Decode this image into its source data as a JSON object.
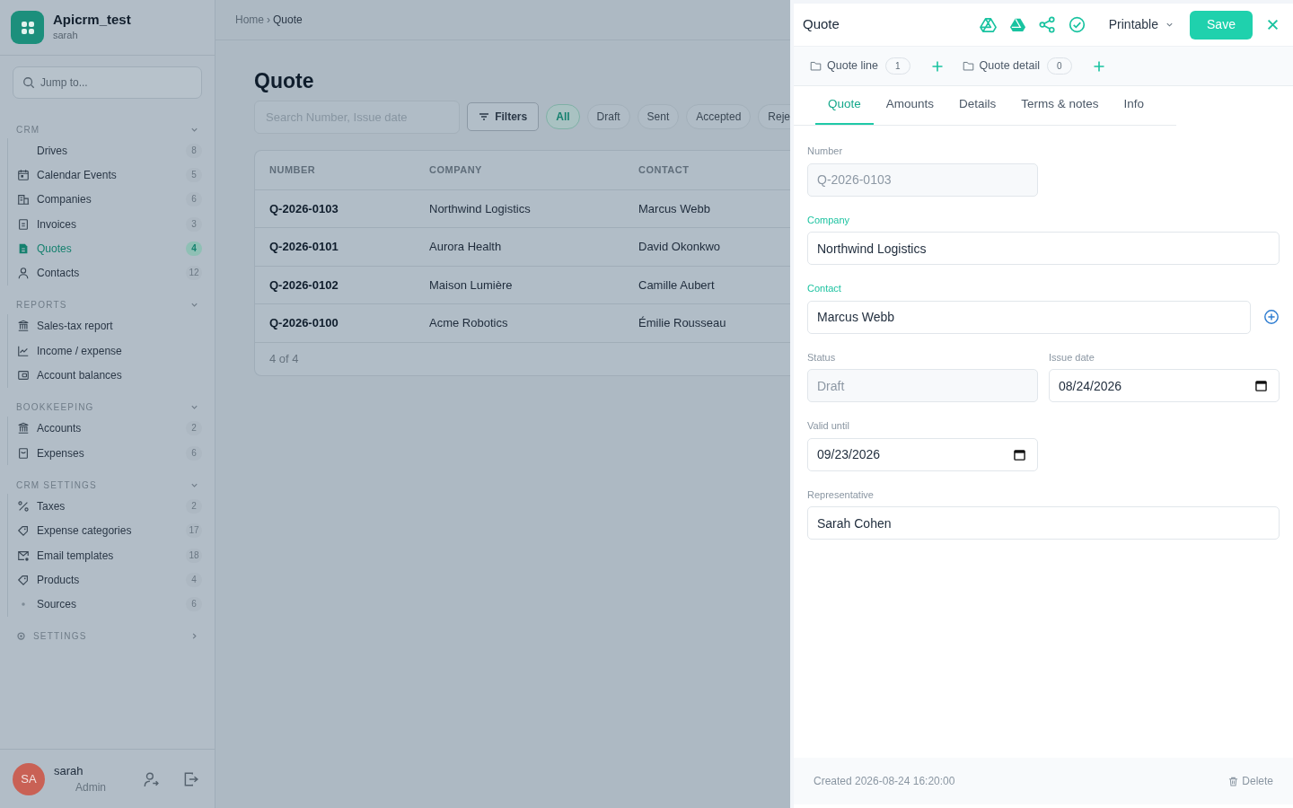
{
  "app": {
    "name": "Apicrm_test",
    "user": "sarah"
  },
  "jump": {
    "placeholder": "Jump to..."
  },
  "nav_sections": [
    {
      "title": "CRM",
      "expanded": true,
      "items": [
        {
          "label": "Drives",
          "count": "8",
          "selected": false
        },
        {
          "label": "Calendar Events",
          "count": "5",
          "selected": false
        },
        {
          "label": "Companies",
          "count": "6",
          "selected": false
        },
        {
          "label": "Invoices",
          "count": "3",
          "selected": false
        },
        {
          "label": "Quotes",
          "count": "4",
          "selected": true
        },
        {
          "label": "Contacts",
          "count": "12",
          "selected": false
        }
      ]
    },
    {
      "title": "REPORTS",
      "expanded": true,
      "items": [
        {
          "label": "Sales-tax report",
          "selected": false
        },
        {
          "label": "Income / expense",
          "selected": false
        },
        {
          "label": "Account balances",
          "selected": false
        }
      ]
    },
    {
      "title": "BOOKKEEPING",
      "expanded": true,
      "items": [
        {
          "label": "Accounts",
          "count": "2",
          "selected": false
        },
        {
          "label": "Expenses",
          "count": "6",
          "selected": false
        }
      ]
    },
    {
      "title": "CRM SETTINGS",
      "expanded": true,
      "items": [
        {
          "label": "Taxes",
          "count": "2",
          "selected": false
        },
        {
          "label": "Expense categories",
          "count": "17",
          "selected": false
        },
        {
          "label": "Email templates",
          "count": "18",
          "selected": false
        },
        {
          "label": "Products",
          "count": "4",
          "selected": false
        },
        {
          "label": "Sources",
          "count": "6",
          "selected": false
        }
      ]
    },
    {
      "title": "SETTINGS",
      "expanded": false
    }
  ],
  "user": {
    "initials": "SA",
    "name": "sarah",
    "role": "Admin"
  },
  "breadcrumb": {
    "items": [
      "Home",
      "Quote"
    ],
    "separator": "›"
  },
  "page": {
    "title": "Quote",
    "search_placeholder": "Search Number, Issue date",
    "filters_label": "Filters",
    "chips": [
      {
        "label": "All",
        "selected": true
      },
      {
        "label": "Draft",
        "selected": false
      },
      {
        "label": "Sent",
        "selected": false
      },
      {
        "label": "Accepted",
        "selected": false
      },
      {
        "label": "Reje",
        "selected": false
      }
    ]
  },
  "table": {
    "columns": [
      "NUMBER",
      "COMPANY",
      "CONTACT"
    ],
    "rows": [
      [
        "Q-2026-0103",
        "Northwind Logistics",
        "Marcus Webb"
      ],
      [
        "Q-2026-0101",
        "Aurora Health",
        "David Okonkwo"
      ],
      [
        "Q-2026-0102",
        "Maison Lumière",
        "Camille Aubert"
      ],
      [
        "Q-2026-0100",
        "Acme Robotics",
        "Émilie Rousseau"
      ]
    ],
    "footer": "4 of 4"
  },
  "panel": {
    "title": "Quote",
    "printable": "Printable",
    "save": "Save",
    "related": [
      {
        "label": "Quote line",
        "count": "1"
      },
      {
        "label": "Quote detail",
        "count": "0"
      }
    ],
    "tabs": [
      {
        "label": "Quote",
        "selected": true
      },
      {
        "label": "Amounts",
        "selected": false
      },
      {
        "label": "Details",
        "selected": false
      },
      {
        "label": "Terms & notes",
        "selected": false
      },
      {
        "label": "Info",
        "selected": false
      }
    ],
    "fields": [
      {
        "kind": "text",
        "label": "Number",
        "value": "Q-2026-0103",
        "required": false,
        "disabled": true,
        "addable": false
      },
      {
        "kind": "lookup",
        "label": "Company",
        "value": "Northwind Logistics",
        "required": true,
        "disabled": false,
        "addable": false
      },
      {
        "kind": "lookup",
        "label": "Contact",
        "value": "Marcus Webb",
        "required": true,
        "disabled": false,
        "addable": true
      },
      {
        "kind": "text",
        "label": "Status",
        "value": "Draft",
        "required": false,
        "disabled": true,
        "addable": false
      },
      {
        "kind": "date",
        "label": "Issue date",
        "value": "08/24/2026",
        "required": false,
        "disabled": false,
        "addable": false
      },
      {
        "kind": "date",
        "label": "Valid until",
        "value": "09/23/2026",
        "required": false,
        "disabled": false,
        "addable": false
      },
      {
        "kind": "lookup",
        "label": "Representative",
        "value": "Sarah Cohen",
        "required": false,
        "disabled": false,
        "addable": false
      }
    ],
    "created": "Created 2026-08-24 16:20:00",
    "delete": "Delete"
  }
}
